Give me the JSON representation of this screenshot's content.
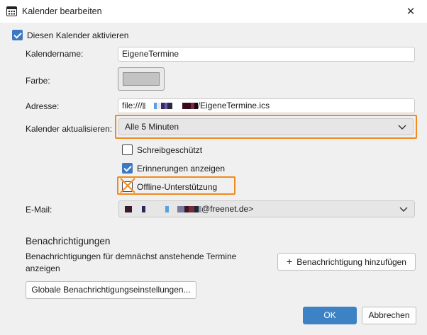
{
  "window": {
    "title": "Kalender bearbeiten"
  },
  "enable": {
    "label": "Diesen Kalender aktivieren",
    "checked": true
  },
  "name": {
    "label": "Kalendername:",
    "value": "EigeneTermine"
  },
  "color": {
    "label": "Farbe:",
    "value": "#c3c3c3"
  },
  "address": {
    "label": "Adresse:",
    "prefix": "file:///",
    "suffix": "/EigeneTermine.ics"
  },
  "refresh": {
    "label": "Kalender aktualisieren:",
    "value": "Alle 5 Minuten"
  },
  "readonly": {
    "label": "Schreibgeschützt",
    "checked": false
  },
  "reminders": {
    "label": "Erinnerungen anzeigen",
    "checked": true
  },
  "offline": {
    "label": "Offline-Unterstützung",
    "checked": false
  },
  "email": {
    "label": "E-Mail:",
    "suffix": "@freenet.de>"
  },
  "notifications": {
    "heading": "Benachrichtigungen",
    "description_line1": "Benachrichtigungen für demnächst anstehende Termine",
    "description_line2": "anzeigen",
    "add_button": "Benachrichtigung hinzufügen",
    "global_button": "Globale Benachrichtigungseinstellungen..."
  },
  "footer": {
    "ok": "OK",
    "cancel": "Abbrechen"
  },
  "colors": {
    "accent": "#3d82c5",
    "highlight": "#f08a1c"
  }
}
